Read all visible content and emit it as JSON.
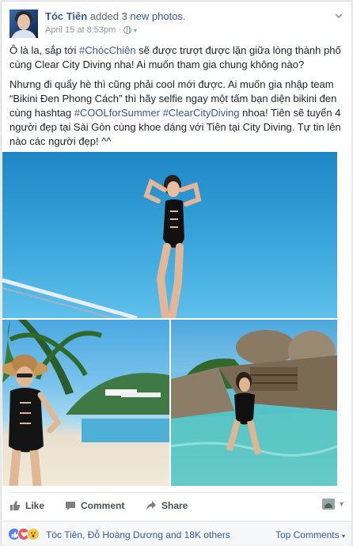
{
  "post": {
    "author": "Tóc Tiên",
    "action_text": " added ",
    "photos_link": "3 new photos",
    "period": ".",
    "timestamp": "April 15 at 8:53pm",
    "separator": " · ",
    "paragraph1": {
      "a": "Ô là la, sắp tới ",
      "tag1": "#ChócChiên",
      "b": " sẽ được trượt được lặn giữa lòng thành phố cùng Clear City Diving nha! Ai muốn tham gia chung không nào?"
    },
    "paragraph2": {
      "a": "Nhưng đi quẩy hè thì cũng phải cool mới được. Ai muốn gia nhập team “Bikini Đen Phong Cách” thì hãy selfie ngay một tấm bạn diện bikini đen cùng hashtag ",
      "tag1": "#COOLforSummer",
      "sp": " ",
      "tag2": "#ClearCityDiving",
      "b": " nhoa! Tiên sẽ tuyển 4 người đẹp tại Sài Gòn cùng khoe dáng với Tiên tại City Diving. Tự tin lên nào các người đẹp! ^^"
    }
  },
  "actions": {
    "like": "Like",
    "comment": "Comment",
    "share": "Share"
  },
  "footer": {
    "reactions_text": "Tóc Tiên, Đỗ Hoàng Dương and 18K others",
    "top_comments": "Top Comments",
    "caret": "▾"
  },
  "icons": {
    "chevron": "chevron-down-icon",
    "globe": "globe-icon",
    "like": "thumbs-up-icon",
    "comment": "comment-icon",
    "share": "share-arrow-icon"
  },
  "colors": {
    "link": "#365899",
    "meta": "#90949c",
    "like_reaction": "#4c82f7",
    "love_reaction": "#f25268",
    "wow_reaction": "#f7c744"
  }
}
